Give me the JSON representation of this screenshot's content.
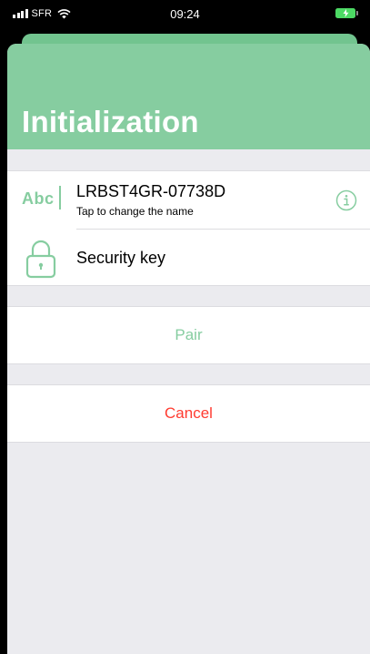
{
  "status_bar": {
    "carrier": "SFR",
    "time": "09:24",
    "icons": [
      "signal-icon",
      "wifi-icon",
      "battery-charging-icon"
    ]
  },
  "colors": {
    "accent": "#86cda0",
    "danger": "#ff3b30",
    "background": "#ebebef"
  },
  "header": {
    "title": "Initialization"
  },
  "device": {
    "name_icon_text": "Abc",
    "name": "LRBST4GR-07738D",
    "hint": "Tap to change the name",
    "info_icon": "info-icon"
  },
  "security": {
    "icon": "lock-icon",
    "label": "Security key"
  },
  "actions": {
    "pair_label": "Pair",
    "cancel_label": "Cancel"
  }
}
